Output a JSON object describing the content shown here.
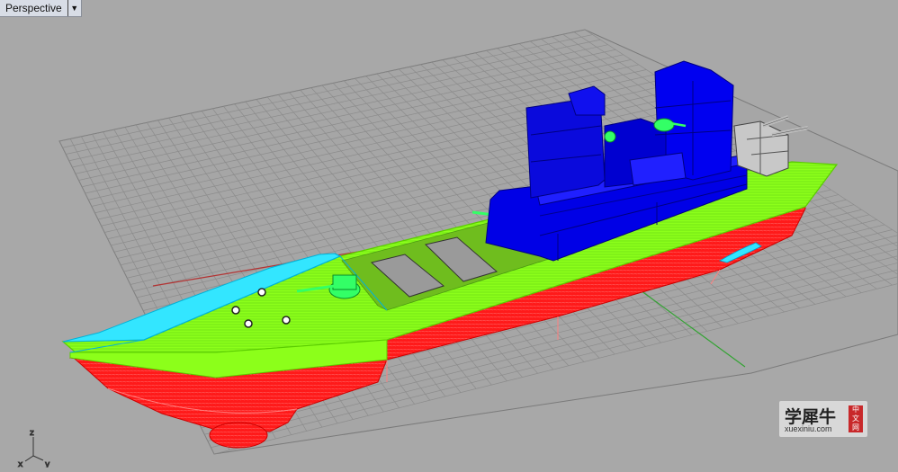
{
  "viewport": {
    "name": "Perspective",
    "menu_arrow": "▼"
  },
  "axes": {
    "x": "x",
    "y": "y",
    "z": "z"
  },
  "watermark": {
    "title": "学犀牛",
    "site": "xuexiniu.com",
    "badge": [
      "中",
      "文",
      "网"
    ]
  },
  "colors": {
    "background": "#a8a8a8",
    "grid": "#8c8c8c",
    "hull": "#ff1a1a",
    "deck": "#8cff1a",
    "superstructure": "#0000e6",
    "turrets": "#33ff66",
    "bow_highlight": "#33e6ff",
    "x_axis": "#b33333",
    "y_axis": "#33a333"
  }
}
